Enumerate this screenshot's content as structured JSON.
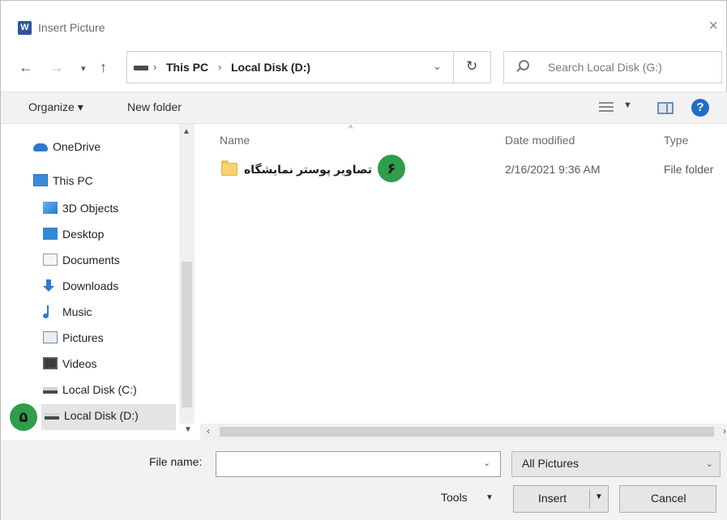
{
  "window": {
    "title": "Insert Picture",
    "app_icon": "W",
    "close_glyph": "×"
  },
  "address": {
    "breadcrumbs": [
      "This PC",
      "Local Disk (D:)"
    ],
    "separator": "›"
  },
  "search": {
    "placeholder": "Search Local Disk (G:)"
  },
  "toolbar": {
    "organize_label": "Organize ▾",
    "new_folder_label": "New folder",
    "help_glyph": "?"
  },
  "sidebar": {
    "items": [
      {
        "label": "OneDrive",
        "icon": "cloud-icon"
      },
      {
        "label": "This PC",
        "icon": "computer-icon"
      },
      {
        "label": "3D Objects",
        "icon": "cube-icon"
      },
      {
        "label": "Desktop",
        "icon": "desktop-icon"
      },
      {
        "label": "Documents",
        "icon": "document-icon"
      },
      {
        "label": "Downloads",
        "icon": "download-icon"
      },
      {
        "label": "Music",
        "icon": "music-icon"
      },
      {
        "label": "Pictures",
        "icon": "picture-icon"
      },
      {
        "label": "Videos",
        "icon": "video-icon"
      },
      {
        "label": "Local Disk (C:)",
        "icon": "disk-icon"
      },
      {
        "label": "Local Disk (D:)",
        "icon": "disk-icon",
        "selected": true
      }
    ]
  },
  "file_list": {
    "columns": [
      "Name",
      "Date modified",
      "Type"
    ],
    "rows": [
      {
        "name": "تصاویر پوستر نمایشگاه",
        "date_modified": "2/16/2021 9:36 AM",
        "type": "File folder"
      }
    ]
  },
  "bottom": {
    "file_name_label": "File name:",
    "file_name_value": "",
    "file_type_selected": "All Pictures",
    "tools_label": "Tools",
    "insert_label": "Insert",
    "cancel_label": "Cancel"
  },
  "annotations": {
    "badge_5": "۵",
    "badge_6": "۶"
  },
  "colors": {
    "badge": "#2f9d4a",
    "help": "#1e6fc4",
    "folder": "#f6d36b"
  }
}
